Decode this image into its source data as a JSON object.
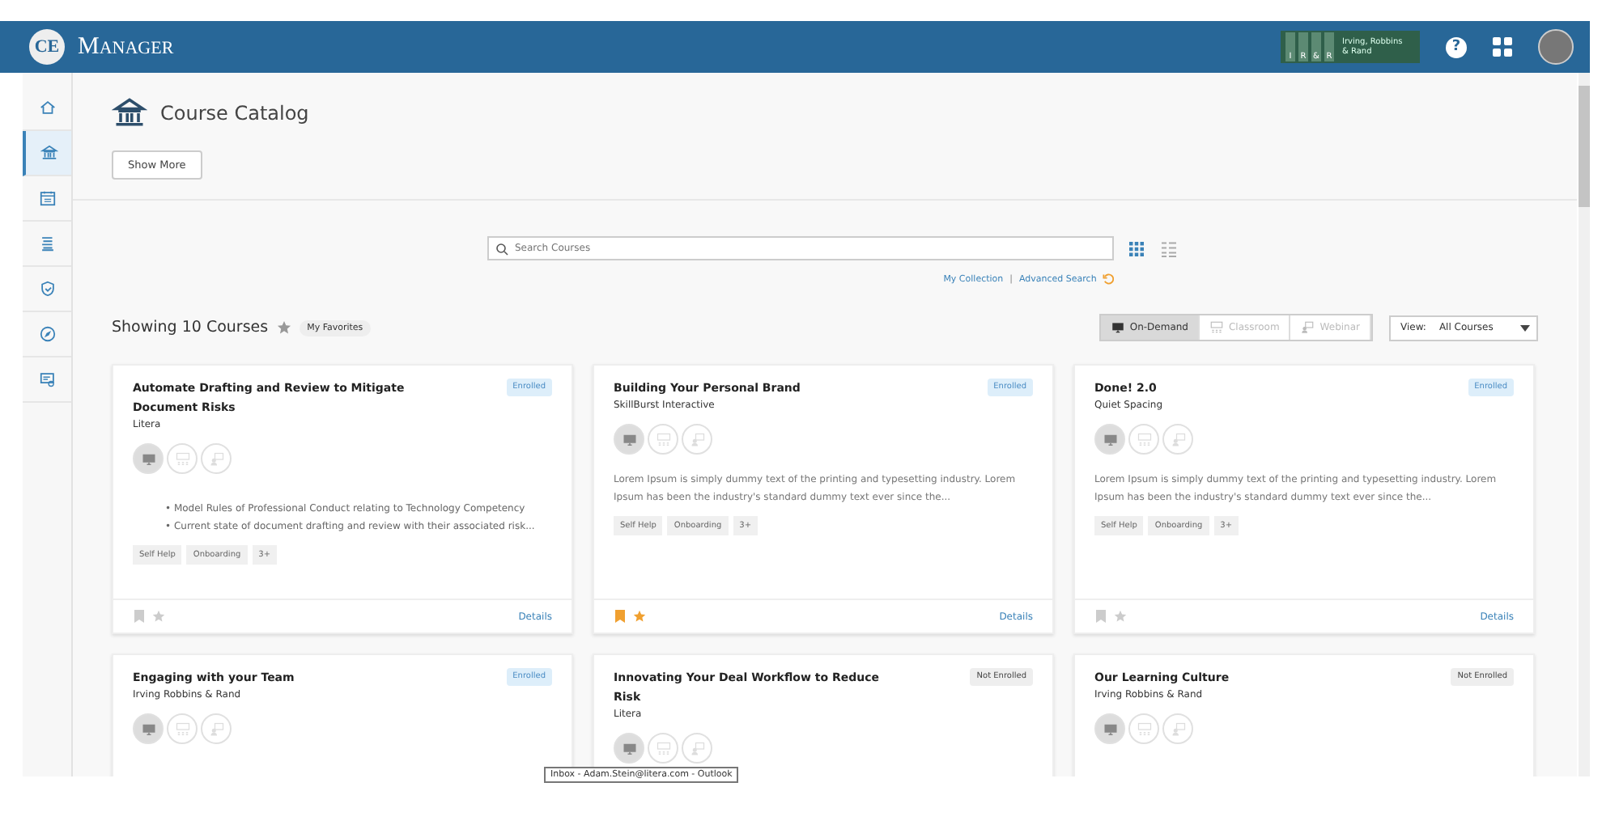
{
  "header": {
    "logo_mark": "CE",
    "logo_text": "Manager",
    "org_logo": {
      "letters": [
        "I",
        "R",
        "&",
        "R"
      ],
      "name": "Irving, Robbins & Rand"
    },
    "help": "?"
  },
  "sidebar": {
    "items": [
      {
        "selected": false
      },
      {
        "selected": true
      },
      {
        "selected": false
      },
      {
        "selected": false
      },
      {
        "selected": false
      },
      {
        "selected": false
      },
      {
        "selected": false
      }
    ]
  },
  "page": {
    "title": "Course Catalog",
    "show_more": "Show More"
  },
  "search": {
    "placeholder": "Search Courses",
    "views": [
      {
        "kind": "grid",
        "selected": true
      },
      {
        "kind": "list",
        "selected": false
      }
    ],
    "links": [
      "My Collection",
      "Advanced Search"
    ],
    "separator": "|"
  },
  "results": {
    "count": "Showing 10 Courses",
    "favorites": "My Favorites",
    "formats": [
      {
        "kind": "monitor",
        "label": "On-Demand",
        "selected": true
      },
      {
        "kind": "classroom",
        "label": "Classroom",
        "selected": false
      },
      {
        "kind": "webinar",
        "label": "Webinar",
        "selected": false
      }
    ],
    "view_label": "View:",
    "view_value": "All Courses"
  },
  "courses": [
    {
      "title": "Automate Drafting and Review to Mitigate Document Risks",
      "provider": "Litera",
      "badge": "Enrolled",
      "enrolled": true,
      "formats": [
        true,
        false,
        false
      ],
      "bullets": [
        "• Model Rules of Professional Conduct relating to Technology Competency",
        "• Current state of document drafting and review with their associated risk..."
      ],
      "tags": [
        "Self Help",
        "Onboarding",
        "3+"
      ],
      "bookmarked": false,
      "favorite": false,
      "link": "Details"
    },
    {
      "title": "Building Your Personal Brand",
      "provider": "SkillBurst Interactive",
      "badge": "Enrolled",
      "enrolled": true,
      "formats": [
        true,
        false,
        false
      ],
      "description": "Lorem Ipsum is simply dummy text of the printing and typesetting industry. Lorem Ipsum has been the industry's standard dummy text ever since the...",
      "tags": [
        "Self Help",
        "Onboarding",
        "3+"
      ],
      "bookmarked": true,
      "favorite": true,
      "link": "Details"
    },
    {
      "title": "Done! 2.0",
      "provider": "Quiet Spacing",
      "badge": "Enrolled",
      "enrolled": true,
      "formats": [
        true,
        false,
        false
      ],
      "description": "Lorem Ipsum is simply dummy text of the printing and typesetting industry. Lorem Ipsum has been the industry's standard dummy text ever since the...",
      "tags": [
        "Self Help",
        "Onboarding",
        "3+"
      ],
      "bookmarked": false,
      "favorite": false,
      "link": "Details"
    },
    {
      "title": "Engaging with your Team",
      "provider": "Irving Robbins & Rand",
      "badge": "Enrolled",
      "enrolled": true,
      "formats": [
        true,
        false,
        false
      ]
    },
    {
      "title": "Innovating Your Deal Workflow to Reduce Risk",
      "provider": "Litera",
      "badge": "Not Enrolled",
      "enrolled": false,
      "formats": [
        true,
        false,
        false
      ]
    },
    {
      "title": "Our Learning Culture",
      "provider": "Irving Robbins & Rand",
      "badge": "Not Enrolled",
      "enrolled": false,
      "formats": [
        true,
        false,
        false
      ]
    }
  ],
  "tooltip": "Inbox - Adam.Stein@litera.com - Outlook"
}
